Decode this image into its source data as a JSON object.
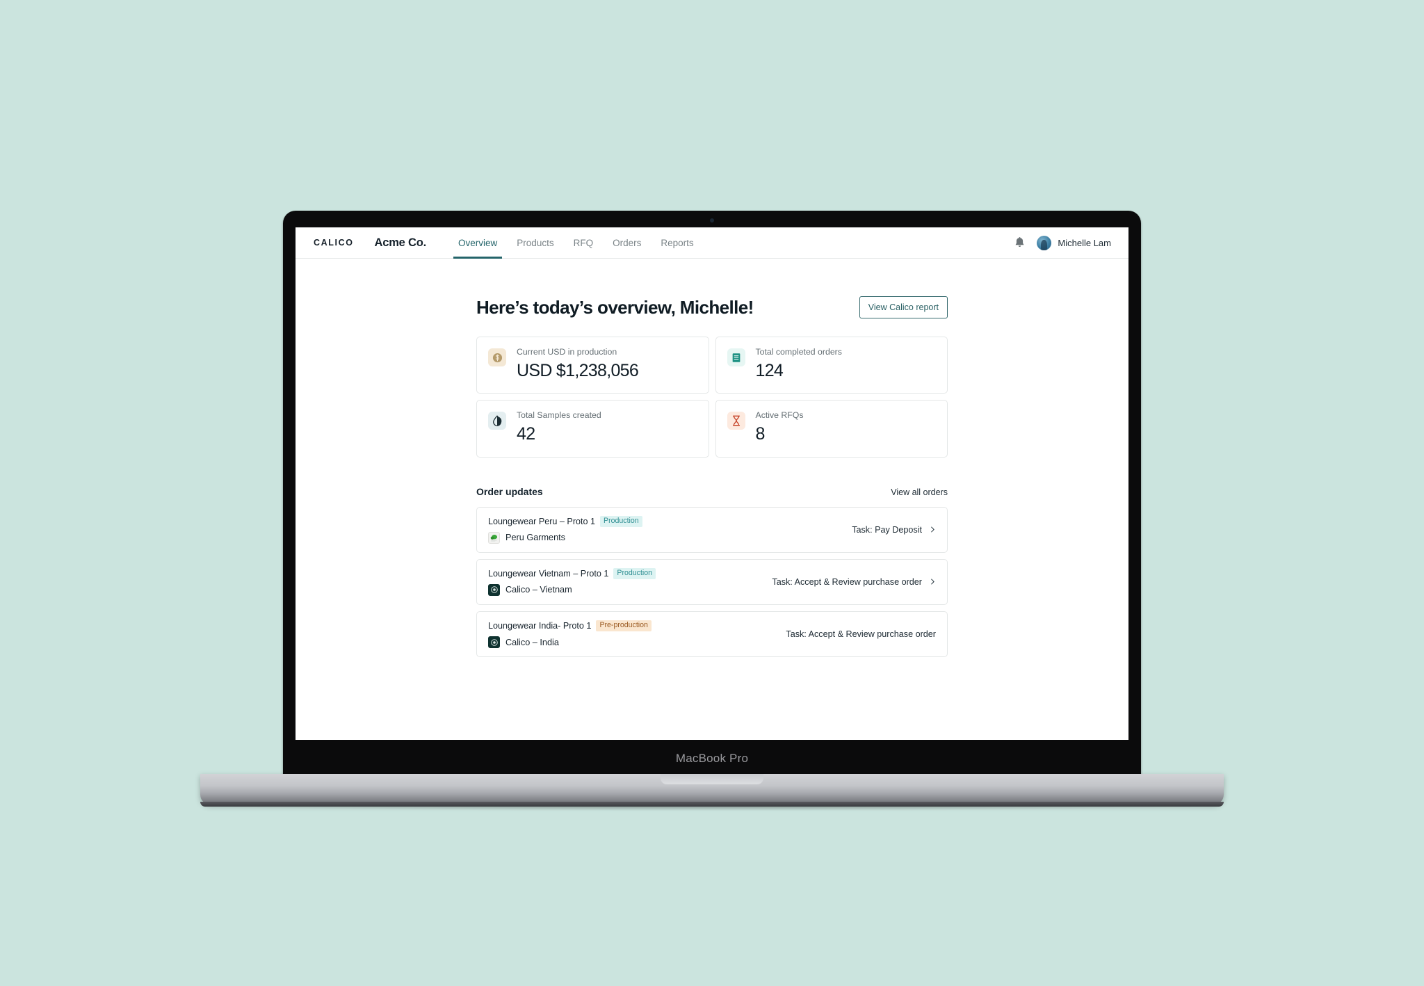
{
  "device": {
    "label": "MacBook Pro"
  },
  "colors": {
    "background": "#cbe4de",
    "accent_teal": "#24646a",
    "badge_production_bg": "#ddf3f2",
    "badge_production_text": "#2f8f93",
    "badge_preproduction_bg": "#fae6cf",
    "badge_preproduction_text": "#9a5a22"
  },
  "topnav": {
    "logo": "CALICO",
    "org": "Acme Co.",
    "links": [
      {
        "label": "Overview",
        "active": true
      },
      {
        "label": "Products",
        "active": false
      },
      {
        "label": "RFQ",
        "active": false
      },
      {
        "label": "Orders",
        "active": false
      },
      {
        "label": "Reports",
        "active": false
      }
    ],
    "bell_icon": "bell-icon",
    "avatar_icon": "user-avatar",
    "user_name": "Michelle Lam"
  },
  "header": {
    "title": "Here’s today’s overview, Michelle!",
    "report_button": "View Calico report"
  },
  "stats": [
    {
      "icon": "dollar-circle-icon",
      "icon_bg": "#f4e8d5",
      "icon_color": "#b49a6a",
      "label": "Current USD in production",
      "value": "USD $1,238,056"
    },
    {
      "icon": "document-lines-icon",
      "icon_bg": "#e6f6f3",
      "icon_color": "#1d9183",
      "label": "Total completed orders",
      "value": "124"
    },
    {
      "icon": "droplet-half-icon",
      "icon_bg": "#e4eef0",
      "icon_color": "#1c2d33",
      "label": "Total Samples created",
      "value": "42"
    },
    {
      "icon": "hourglass-icon",
      "icon_bg": "#fdeadf",
      "icon_color": "#c33d22",
      "label": "Active RFQs",
      "value": "8"
    }
  ],
  "orders": {
    "title": "Order updates",
    "view_all": "View all orders",
    "rows": [
      {
        "name": "Loungewear Peru – Proto 1",
        "badge": "Production",
        "badge_type": "production",
        "supplier": "Peru Garments",
        "supplier_logo": "peru-garments-logo",
        "task": "Task: Pay Deposit",
        "has_chevron": true
      },
      {
        "name": "Loungewear Vietnam – Proto 1",
        "badge": "Production",
        "badge_type": "production",
        "supplier": "Calico – Vietnam",
        "supplier_logo": "calico-logo",
        "task": "Task: Accept & Review purchase order",
        "has_chevron": true
      },
      {
        "name": "Loungewear India- Proto 1",
        "badge": "Pre-production",
        "badge_type": "preproduction",
        "supplier": "Calico – India",
        "supplier_logo": "calico-logo",
        "task": "Task: Accept & Review purchase order",
        "has_chevron": false
      }
    ]
  }
}
